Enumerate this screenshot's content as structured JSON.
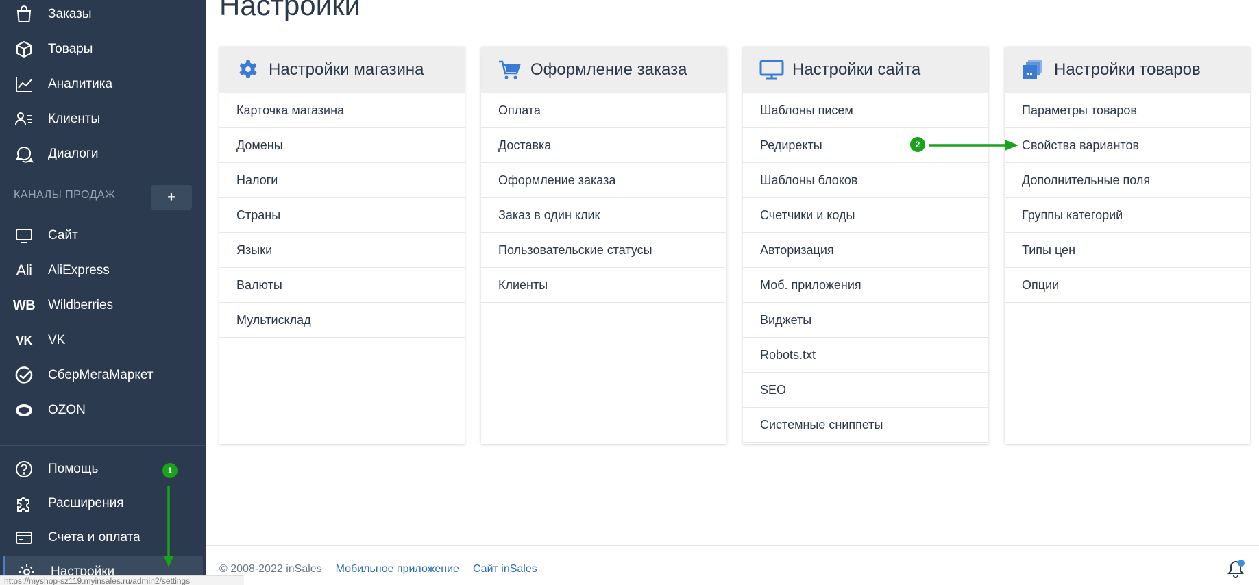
{
  "sidebar": {
    "top_items": [
      {
        "label": "Заказы",
        "icon": "bag-icon"
      },
      {
        "label": "Товары",
        "icon": "box-icon"
      },
      {
        "label": "Аналитика",
        "icon": "chart-icon"
      },
      {
        "label": "Клиенты",
        "icon": "clients-icon"
      },
      {
        "label": "Диалоги",
        "icon": "chat-icon"
      }
    ],
    "channels_title": "КАНАЛЫ ПРОДАЖ",
    "add_label": "+",
    "channels": [
      {
        "label": "Сайт",
        "icon": "monitor-icon"
      },
      {
        "label": "AliExpress",
        "icon": "ali-icon",
        "glyph": "Ali"
      },
      {
        "label": "Wildberries",
        "icon": "wb-icon",
        "glyph": "WB"
      },
      {
        "label": "VK",
        "icon": "vk-icon",
        "glyph": "VK"
      },
      {
        "label": "СберМегаМаркет",
        "icon": "sber-icon"
      },
      {
        "label": "OZON",
        "icon": "ozon-icon"
      }
    ],
    "bottom_items": [
      {
        "label": "Помощь",
        "icon": "help-icon"
      },
      {
        "label": "Расширения",
        "icon": "puzzle-icon"
      },
      {
        "label": "Счета и оплата",
        "icon": "card-icon"
      },
      {
        "label": "Настройки",
        "icon": "gear-icon",
        "active": true
      }
    ]
  },
  "page": {
    "title": "Настройки"
  },
  "cards": [
    {
      "title": "Настройки магазина",
      "icon": "gear-icon",
      "items": [
        "Карточка магазина",
        "Домены",
        "Налоги",
        "Страны",
        "Языки",
        "Валюты",
        "Мультисклад"
      ]
    },
    {
      "title": "Оформление заказа",
      "icon": "cart-icon",
      "items": [
        "Оплата",
        "Доставка",
        "Оформление заказа",
        "Заказ в один клик",
        "Пользовательские статусы",
        "Клиенты"
      ]
    },
    {
      "title": "Настройки сайта",
      "icon": "monitor-icon",
      "items": [
        "Шаблоны писем",
        "Редиректы",
        "Шаблоны блоков",
        "Счетчики и коды",
        "Авторизация",
        "Моб. приложения",
        "Виджеты",
        "Robots.txt",
        "SEO",
        "Системные сниппеты"
      ]
    },
    {
      "title": "Настройки товаров",
      "icon": "products-icon",
      "items": [
        "Параметры товаров",
        "Свойства вариантов",
        "Дополнительные поля",
        "Группы категорий",
        "Типы цен",
        "Опции"
      ]
    }
  ],
  "footer": {
    "copyright": "© 2008-2022 inSales",
    "link_mobile": "Мобильное приложение",
    "link_site": "Сайт inSales"
  },
  "annotations": {
    "badge1": "1",
    "badge2": "2",
    "color": "#1aa31a"
  },
  "status_url": "https://myshop-sz119.myinsales.ru/admin2/settings",
  "colors": {
    "sidebar_bg": "#2b3a4e",
    "accent_blue": "#2f6db5",
    "icon_blue": "#3a7bd5"
  }
}
